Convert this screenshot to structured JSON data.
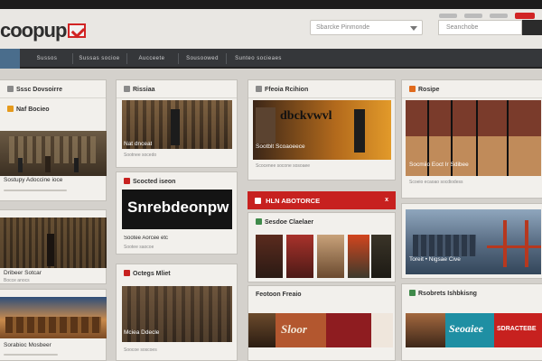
{
  "logo": {
    "text": "coopup"
  },
  "header": {
    "dropdown_placeholder": "Sbarcke Pinmonde",
    "search_placeholder": "Seanchobe"
  },
  "nav": {
    "items": [
      "",
      "Sussos",
      "Sussas socioe",
      "Aucceete",
      "Sousoowed",
      "Sunteo socieaes"
    ]
  },
  "col1": {
    "card1": {
      "title": "Sssc Dovsoirre",
      "sub_title": "Naf Bocieo",
      "caption": "Sostupy Adoccine ioce"
    },
    "card2": {
      "caption": "Dribeer Sotcar",
      "sub": "Bocce anocs"
    },
    "card3": {
      "caption": "Sorabioc Mosbeer"
    }
  },
  "col2": {
    "card1": {
      "title": "Rissiaa",
      "caption": "Nat dnceat",
      "sub": "Sootnee socedo"
    },
    "card2": {
      "title": "Scocted iseon",
      "banner": "Snrebdeonpw",
      "caption": "Sootee Aorcee etc",
      "sub": "Sootee saocoe"
    },
    "card3": {
      "title": "Octegs Mliet",
      "caption": "Mciea Ddecle",
      "sub": "Soocoe soscoes"
    }
  },
  "col3": {
    "card1": {
      "title": "Ffeoia Rcihion",
      "banner": "dbckvwvl",
      "caption": "Sootblt Scoaoeece",
      "sub": "Scocenee socone sosoaee"
    },
    "redbar": {
      "title": "HLN ABOTORCE",
      "close": "x"
    },
    "card2": {
      "title": "Sesdoe Claelaer"
    },
    "card3": {
      "title": "Feotoon Freaio",
      "banner": "Sloor"
    }
  },
  "col4": {
    "card1": {
      "title": "Rosipe",
      "caption": "Socmiio Eoct Ir Sdibee",
      "sub": "Scoeio ecaoao socdiodess"
    },
    "card2": {
      "caption": "Toreit • Nigsae Cive"
    },
    "card3": {
      "title": "Rsobrets Ishbkisng",
      "banner1": "Seoaiee",
      "banner2": "SDRACTEBE"
    }
  },
  "colors": {
    "accent": "#c7211f",
    "nav_active": "#4a6d8c",
    "nav_bg": "#35373a",
    "card_bg": "#f2f0ec"
  }
}
